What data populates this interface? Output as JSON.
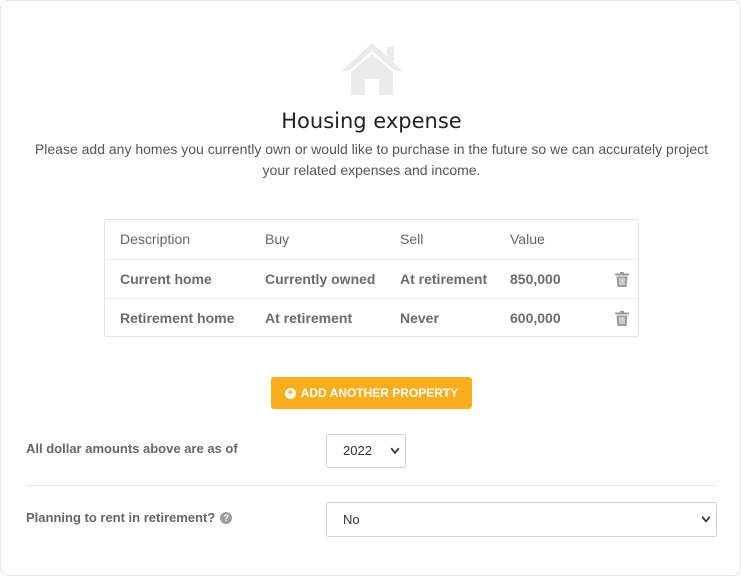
{
  "header": {
    "title": "Housing expense",
    "subtitle": "Please add any homes you currently own or would like to purchase in the future so we can accurately project your related expenses and income."
  },
  "table": {
    "columns": [
      "Description",
      "Buy",
      "Sell",
      "Value"
    ],
    "rows": [
      {
        "description": "Current home",
        "buy": "Currently owned",
        "sell": "At retirement",
        "value": "850,000"
      },
      {
        "description": "Retirement home",
        "buy": "At retirement",
        "sell": "Never",
        "value": "600,000"
      }
    ]
  },
  "add_button": {
    "label": "ADD ANOTHER PROPERTY"
  },
  "dollar_year": {
    "label": "All dollar amounts above are as of",
    "value": "2022"
  },
  "rent": {
    "label": "Planning to rent in retirement?",
    "value": "No"
  },
  "colors": {
    "accent": "#fbad1c",
    "icon_gray": "#e8e8e8"
  },
  "icons": {
    "house": "house-icon",
    "trash": "trash-icon",
    "add": "plus-circle-icon",
    "help": "question-circle-icon",
    "dropdown": "chevron-down-icon"
  }
}
